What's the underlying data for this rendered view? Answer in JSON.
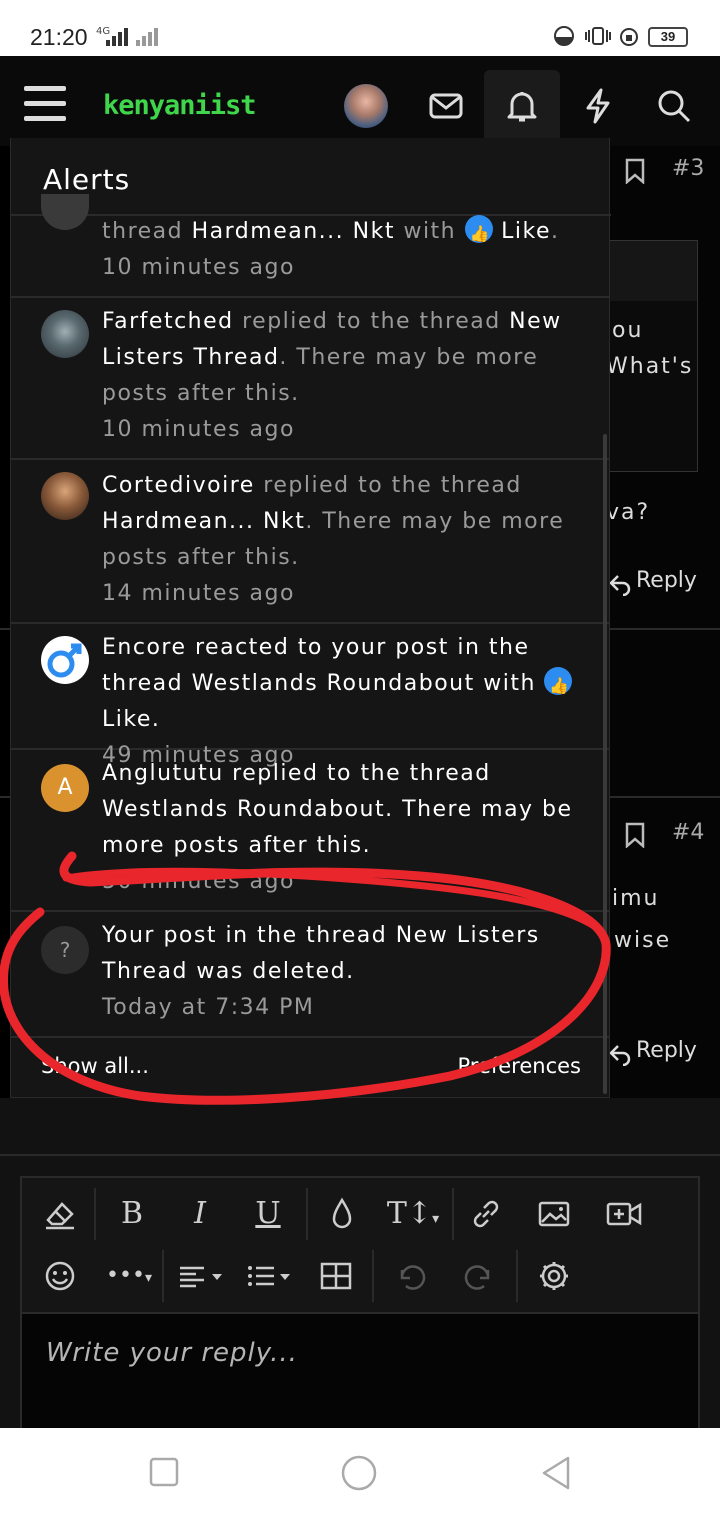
{
  "status_bar": {
    "time": "21:20",
    "network": "4G",
    "battery": "39"
  },
  "nav": {
    "logo": "kenyaniist",
    "icons": [
      "menu-icon",
      "avatar",
      "mail-icon",
      "bell-icon",
      "bolt-icon",
      "search-icon"
    ]
  },
  "alerts": {
    "title": "Alerts",
    "items": [
      {
        "actor": "",
        "prefix": "thread ",
        "thread": "Hardmean... Nkt",
        "suffix": " with ",
        "reaction": "Like",
        "end": ".",
        "time": "10 minutes ago"
      },
      {
        "actor": "Farfetched",
        "prefix": " replied to the thread ",
        "thread": "New Listers Thread",
        "suffix": ". There may be more posts after this.",
        "time": "10 minutes ago"
      },
      {
        "actor": "Cortedivoire",
        "prefix": " replied to the thread ",
        "thread": "Hardmean... Nkt",
        "suffix": ". There may be more posts after this.",
        "time": "14 minutes ago"
      },
      {
        "actor": "Encore",
        "prefix": " reacted to your post in the thread ",
        "thread": "Westlands Roundabout",
        "suffix": " with ",
        "reaction": "Like",
        "end": ".",
        "time": "49 minutes ago"
      },
      {
        "actor": "Anglututu",
        "avatar_letter": "A",
        "prefix": " replied to the thread ",
        "thread": "Westlands Roundabout",
        "suffix": ". There may be more posts after this.",
        "time": "50 minutes ago"
      },
      {
        "avatar_letter": "?",
        "text1": "Your post in the thread ",
        "thread": "New Listers Thread",
        "text2": " was deleted.",
        "time": "Today at 7:34 PM"
      }
    ],
    "show_all": "Show all...",
    "preferences": "Preferences"
  },
  "background": {
    "post_num_3": "#3",
    "post_num_4": "#4",
    "text_ou": "ou",
    "text_whats": "What's",
    "text_va": "va?",
    "text_imu": "imu",
    "text_wise": "wise",
    "reply1": "Reply",
    "reply2": "Reply"
  },
  "editor": {
    "placeholder": "Write your reply..."
  },
  "colors": {
    "logo": "#3fd64b",
    "like": "#2d8cf0",
    "annotation": "#e8262b",
    "anglututu_avatar": "#d9922e"
  }
}
